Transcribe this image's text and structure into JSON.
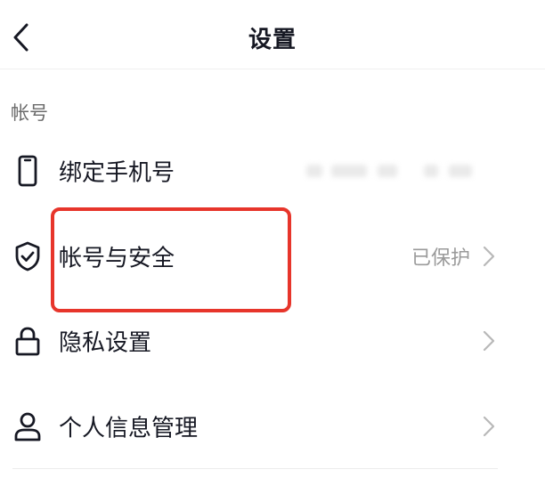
{
  "header": {
    "title": "设置",
    "back_icon": "chevron-left-icon"
  },
  "sections": [
    {
      "label": "帐号",
      "items": [
        {
          "icon": "phone-icon",
          "label": "绑定手机号",
          "value": "",
          "value_masked": true,
          "chevron": false
        },
        {
          "icon": "shield-check-icon",
          "label": "帐号与安全",
          "value": "已保护",
          "chevron": true,
          "highlighted": true
        },
        {
          "icon": "lock-icon",
          "label": "隐私设置",
          "value": "",
          "chevron": true
        },
        {
          "icon": "user-icon",
          "label": "个人信息管理",
          "value": "",
          "chevron": true
        }
      ]
    }
  ],
  "colors": {
    "text_primary": "#161823",
    "text_secondary": "#9a9a9a",
    "highlight_border": "#e7352b",
    "divider": "#efefef"
  }
}
